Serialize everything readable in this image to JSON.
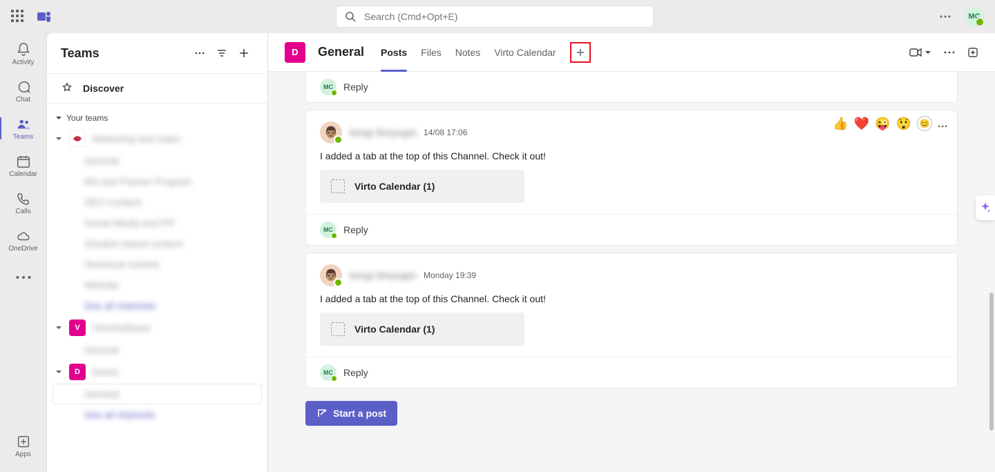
{
  "search": {
    "placeholder": "Search (Cmd+Opt+E)"
  },
  "user": {
    "initials": "MC"
  },
  "rail": [
    {
      "label": "Activity",
      "id": "activity"
    },
    {
      "label": "Chat",
      "id": "chat"
    },
    {
      "label": "Teams",
      "id": "teams"
    },
    {
      "label": "Calendar",
      "id": "calendar"
    },
    {
      "label": "Calls",
      "id": "calls"
    },
    {
      "label": "OneDrive",
      "id": "onedrive"
    }
  ],
  "rail_apps": {
    "label": "Apps"
  },
  "list": {
    "title": "Teams",
    "discover": "Discover",
    "section": "Your teams",
    "teams": [
      {
        "name": "Marketing and Sales",
        "initial": "",
        "color": "#fff",
        "channels": [
          "General",
          "MS and Partner Program",
          "SEO Content",
          "Social Media and PR",
          "Solution based content",
          "Technical content",
          "Website"
        ],
        "see_all": "See all channels"
      },
      {
        "name": "VirtoSoftware",
        "initial": "V",
        "color": "#e3008c",
        "channels": [
          "General"
        ]
      },
      {
        "name": "Demo",
        "initial": "D",
        "color": "#e3008c",
        "channels": [
          "General"
        ],
        "see_all": "See all channels",
        "active_channel": "General"
      }
    ]
  },
  "channel": {
    "name": "General",
    "initial": "D",
    "tabs": [
      "Posts",
      "Files",
      "Notes",
      "Virto Calendar"
    ],
    "active_tab": "Posts"
  },
  "posts": [
    {
      "author": "Sergi Sinyugin",
      "time": "14/08 17:06",
      "body": "I added a tab at the top of this Channel. Check it out!",
      "attachment": "Virto Calendar (1)",
      "reply_label": "Reply",
      "reply_avatar": "MC",
      "show_reactions": true
    },
    {
      "author": "Sergi Sinyugin",
      "time": "Monday 19:39",
      "body": "I added a tab at the top of this Channel. Check it out!",
      "attachment": "Virto Calendar (1)",
      "reply_label": "Reply",
      "reply_avatar": "MC",
      "show_reactions": false
    }
  ],
  "top_reply": {
    "label": "Reply",
    "avatar": "MC"
  },
  "reactions": [
    "👍",
    "❤️",
    "😜",
    "😲"
  ],
  "compose": {
    "label": "Start a post"
  }
}
